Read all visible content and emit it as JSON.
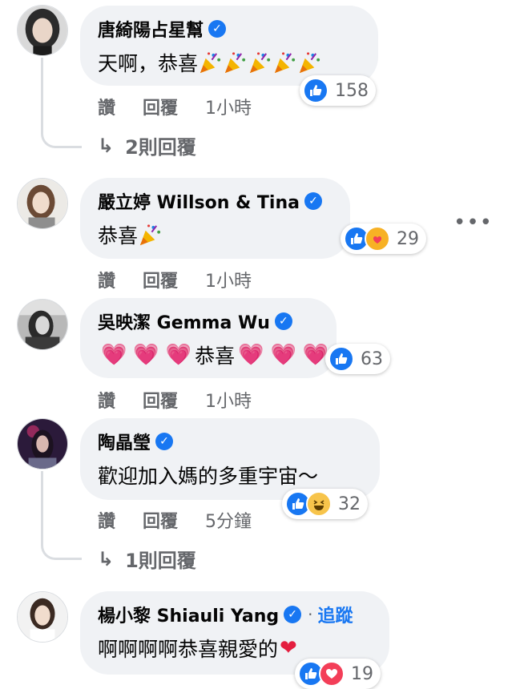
{
  "comments": [
    {
      "author": "唐綺陽占星幫",
      "verified": true,
      "text": "天啊，恭喜",
      "reaction_count": "158",
      "reactions": [
        "like"
      ],
      "actions": {
        "like": "讚",
        "reply": "回覆",
        "time": "1小時"
      },
      "replies": "2則回覆"
    },
    {
      "author": "嚴立婷 Willson & Tina",
      "verified": true,
      "text": "恭喜",
      "reaction_count": "29",
      "reactions": [
        "like",
        "care"
      ],
      "actions": {
        "like": "讚",
        "reply": "回覆",
        "time": "1小時"
      }
    },
    {
      "author": "吳映潔 Gemma Wu",
      "verified": true,
      "text": "恭喜",
      "reaction_count": "63",
      "reactions": [
        "like"
      ],
      "actions": {
        "like": "讚",
        "reply": "回覆",
        "time": "1小時"
      }
    },
    {
      "author": "陶晶瑩",
      "verified": true,
      "text": "歡迎加入媽的多重宇宙～",
      "reaction_count": "32",
      "reactions": [
        "like",
        "haha"
      ],
      "actions": {
        "like": "讚",
        "reply": "回覆",
        "time": "5分鐘"
      },
      "replies": "1則回覆"
    },
    {
      "author": "楊小黎 Shiauli Yang",
      "verified": true,
      "follow": "追蹤",
      "text": "啊啊啊啊恭喜親愛的",
      "reaction_count": "19",
      "reactions": [
        "like",
        "love"
      ]
    }
  ],
  "more_icon": "more-horizontal-icon",
  "colors": {
    "accent": "#1877f2",
    "bubble": "#f0f2f5",
    "muted": "#65676b"
  }
}
